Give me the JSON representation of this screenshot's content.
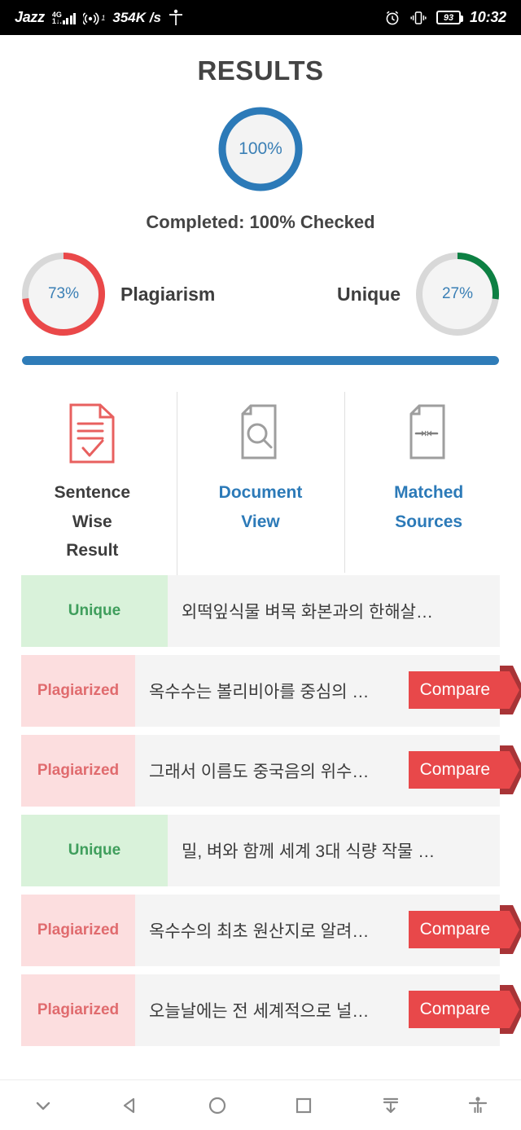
{
  "status_bar": {
    "carrier": "Jazz",
    "network_type": "4G",
    "network_sub": "1↓.",
    "hotspot_sup": "1",
    "data_rate": "354K /s",
    "accessibility_icon": "accessibility-person-icon",
    "alarm_icon": "alarm-clock-icon",
    "vibrate_icon": "vibrate-icon",
    "battery_level": "93",
    "time": "10:32"
  },
  "header": {
    "title": "RESULTS"
  },
  "overall": {
    "percent_label": "100%",
    "percent_value": 100,
    "completed_text": "Completed: 100% Checked",
    "ring_color": "#2c7ab8",
    "track_color": "#f3f3f3"
  },
  "gauges": [
    {
      "label": "Plagiarism",
      "percent_label": "73%",
      "percent_value": 73,
      "color": "#ea4849",
      "track_color": "#d8d8d8",
      "position": "left"
    },
    {
      "label": "Unique",
      "percent_label": "27%",
      "percent_value": 27,
      "color": "#0d8043",
      "track_color": "#d8d8d8",
      "position": "right"
    }
  ],
  "progress": {
    "percent_value": 100,
    "color": "#2f7cb8"
  },
  "tabs": [
    {
      "label_lines": [
        "Sentence",
        "Wise",
        "Result"
      ],
      "icon": "document-check-icon",
      "active": true,
      "color": "#3d3d3d",
      "icon_color": "#e8605f"
    },
    {
      "label_lines": [
        "Document",
        "View"
      ],
      "icon": "document-search-icon",
      "active": false,
      "color": "#2c7ab8",
      "icon_color": "#9e9e9e"
    },
    {
      "label_lines": [
        "Matched",
        "Sources"
      ],
      "icon": "document-arrows-icon",
      "active": false,
      "color": "#2c7ab8",
      "icon_color": "#9e9e9e"
    }
  ],
  "compare_label": "Compare",
  "results": [
    {
      "status": "Unique",
      "type": "unique",
      "text": "외떡잎식물 벼목 화본과의 한해살…",
      "has_compare": false
    },
    {
      "status": "Plagiarized",
      "type": "plag",
      "text": "옥수수는 볼리비아를 중심의 …",
      "has_compare": true
    },
    {
      "status": "Plagiarized",
      "type": "plag",
      "text": "그래서 이름도 중국음의 위수…",
      "has_compare": true
    },
    {
      "status": "Unique",
      "type": "unique",
      "text": "밀, 벼와 함께 세계 3대 식량 작물 …",
      "has_compare": false
    },
    {
      "status": "Plagiarized",
      "type": "plag",
      "text": "옥수수의 최초 원산지로 알려…",
      "has_compare": true
    },
    {
      "status": "Plagiarized",
      "type": "plag",
      "text": "오늘날에는 전 세계적으로 널…",
      "has_compare": true
    }
  ],
  "navbar": [
    {
      "icon": "chevron-down-icon"
    },
    {
      "icon": "back-triangle-icon"
    },
    {
      "icon": "home-circle-icon"
    },
    {
      "icon": "recents-square-icon"
    },
    {
      "icon": "scroll-down-icon"
    },
    {
      "icon": "accessibility-person-icon"
    }
  ]
}
